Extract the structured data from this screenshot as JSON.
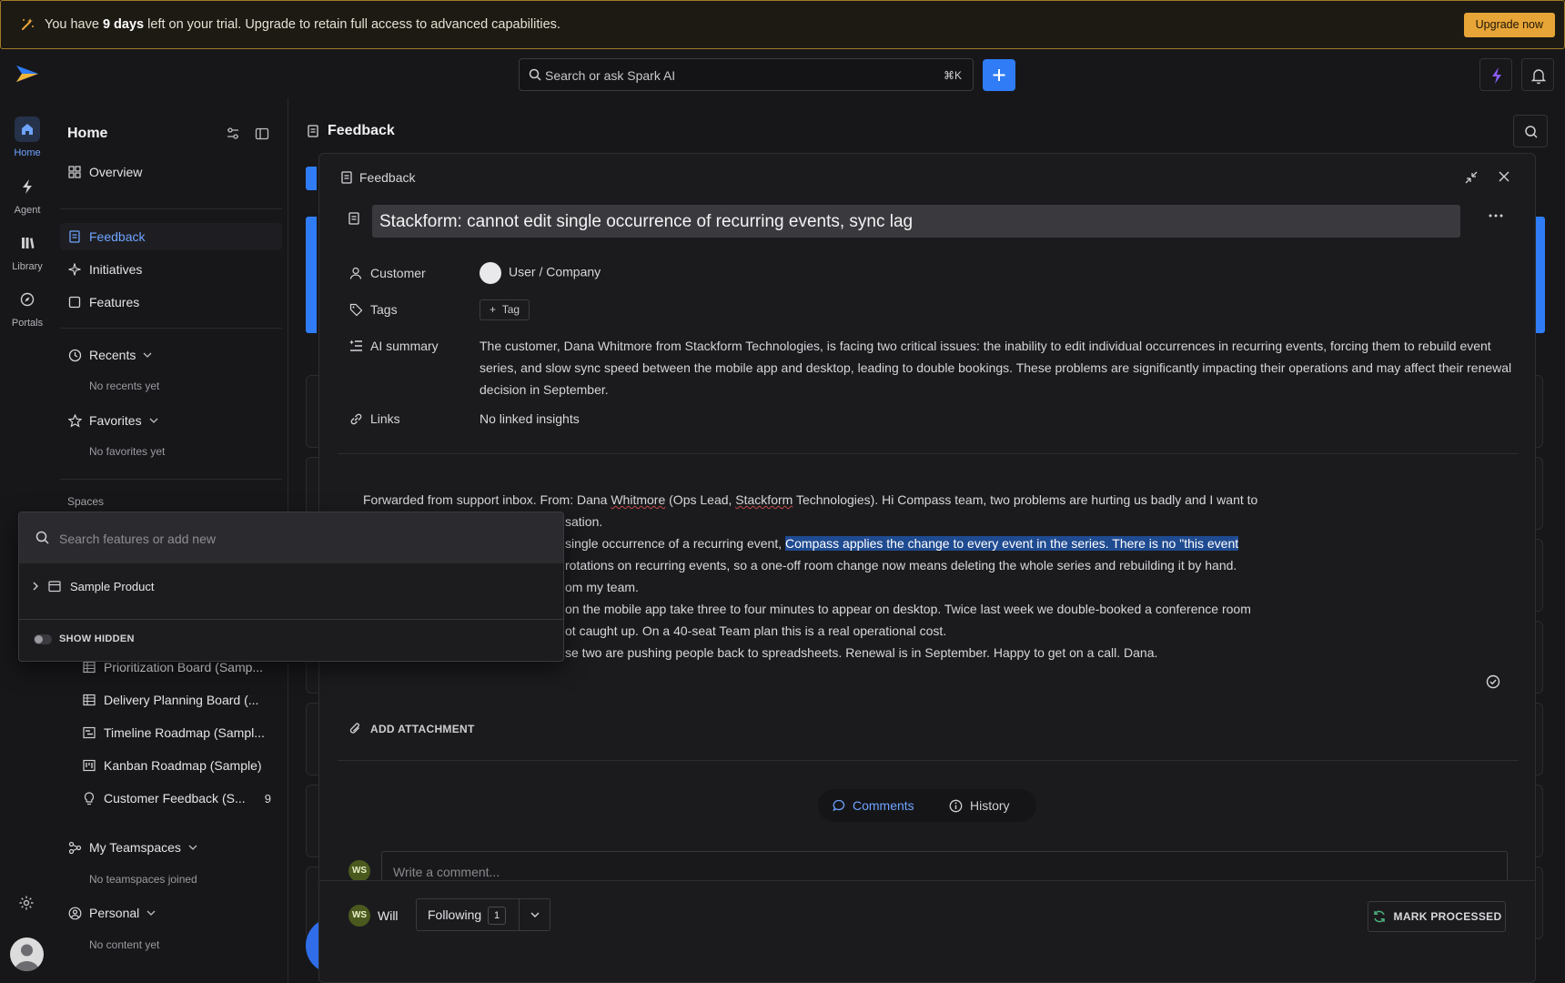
{
  "banner": {
    "prefix": "You have ",
    "bold": "9 days",
    "suffix": " left on your trial. Upgrade to retain full access to advanced capabilities.",
    "upgrade_label": "Upgrade now",
    "accent": "#e8a537"
  },
  "header": {
    "search_placeholder": "Search or ask Spark AI",
    "search_shortcut": "⌘K",
    "add_button_color": "#2f7cf6"
  },
  "rail": {
    "items": [
      {
        "label": "Home",
        "icon": "home-icon",
        "active": true
      },
      {
        "label": "Agent",
        "icon": "bolt-icon"
      },
      {
        "label": "Library",
        "icon": "library-icon"
      },
      {
        "label": "Portals",
        "icon": "compass-icon"
      }
    ]
  },
  "sidebar": {
    "title": "Home",
    "nav": [
      {
        "label": "Overview",
        "icon": "grid-icon"
      },
      {
        "label": "Feedback",
        "icon": "document-icon",
        "active": true
      },
      {
        "label": "Initiatives",
        "icon": "sparkle-icon"
      },
      {
        "label": "Features",
        "icon": "square-icon"
      }
    ],
    "recents": {
      "label": "Recents",
      "empty": "No recents yet"
    },
    "favorites": {
      "label": "Favorites",
      "empty": "No favorites yet"
    },
    "spaces_label": "Spaces",
    "space_items": [
      {
        "label": "Prioritization Board (Samp...",
        "icon": "table-icon"
      },
      {
        "label": "Delivery Planning Board (...",
        "icon": "table-icon"
      },
      {
        "label": "Timeline Roadmap (Sampl...",
        "icon": "timeline-icon"
      },
      {
        "label": "Kanban Roadmap (Sample)",
        "icon": "kanban-icon"
      },
      {
        "label": "Customer Feedback (S...",
        "icon": "lightbulb-icon",
        "badge": "9"
      }
    ],
    "teamspaces": {
      "label": "My Teamspaces",
      "empty": "No teamspaces joined"
    },
    "personal": {
      "label": "Personal",
      "empty": "No content yet"
    }
  },
  "page": {
    "title": "Feedback"
  },
  "modal": {
    "header_title": "Feedback",
    "title": "Stackform: cannot edit single occurrence of recurring events, sync lag",
    "props": {
      "customer_label": "Customer",
      "customer_value": "User / Company",
      "tags_label": "Tags",
      "tag_button": "Tag",
      "ai_summary_label": "AI summary",
      "ai_summary": "The customer, Dana Whitmore from Stackform Technologies, is facing two critical issues: the inability to edit individual occurrences in recurring events, forcing them to rebuild event series, and slow sync speed between the mobile app and desktop, leading to double bookings. These problems are significantly impacting their operations and may affect their renewal decision in September.",
      "links_label": "Links",
      "links_value": "No linked insights"
    },
    "body": {
      "l1a": "Forwarded from support inbox. From: Dana ",
      "l1b": "Whitmore",
      "l1c": " (Ops Lead, ",
      "l1d": "Stackform",
      "l1e": " Technologies). Hi Compass team, two problems are hurting us badly and I want to",
      "l2": "sation.",
      "l3a": " single occurrence of a recurring event, ",
      "l3b": "Compass applies the change to every event in the series. There is no \"this event",
      "l4": " rotations on recurring events, so a one-off room change now means deleting the whole series and rebuilding it by hand.",
      "l5": "om my team.",
      "l6": " on the mobile app take three to four minutes to appear on desktop. Twice last week we double-booked a conference room",
      "l7": "ot caught up. On a 40-seat Team plan this is a real operational cost.",
      "l8": "se two are pushing people back to spreadsheets. Renewal is in September. Happy to get on a call. Dana."
    },
    "attachment_label": "ADD ATTACHMENT",
    "tabs": {
      "comments": "Comments",
      "history": "History"
    },
    "comment_placeholder": "Write a comment...",
    "user_initials": "WS",
    "user_name": "Will",
    "following_label": "Following",
    "following_count": "1",
    "mark_processed": "MARK PROCESSED"
  },
  "popover": {
    "search_placeholder": "Search features or add new",
    "item": "Sample Product",
    "toggle_label": "SHOW HIDDEN"
  }
}
